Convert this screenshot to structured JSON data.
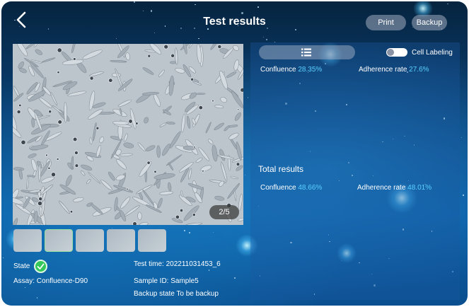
{
  "header": {
    "title": "Test results",
    "print_label": "Print",
    "backup_label": "Backup"
  },
  "image_viewer": {
    "page_indicator": "2/5",
    "thumbnail_count": 5,
    "selected_thumbnail": 2
  },
  "info": {
    "state_label": "State",
    "assay": "Assay: Confluence-D90",
    "test_time": "Test time: 202211031453_6",
    "sample_id": "Sample ID: Sample5",
    "backup_state": "Backup state To be backup"
  },
  "results_panel": {
    "cell_labeling_label": "Cell Labeling",
    "cell_labeling_on": false,
    "current": {
      "confluence_label": "Confluence",
      "confluence_value": "28.35%",
      "adherence_label": "Adherence rate",
      "adherence_value": "27.6%"
    },
    "total": {
      "heading": "Total results",
      "confluence_label": "Confluence",
      "confluence_value": "48.66%",
      "adherence_label": "Adherence rate",
      "adherence_value": "48.01%"
    }
  },
  "colors": {
    "value_accent": "#5ad0ff",
    "state_ok": "#34c759",
    "selected_thumb_border": "#9fe29f"
  }
}
